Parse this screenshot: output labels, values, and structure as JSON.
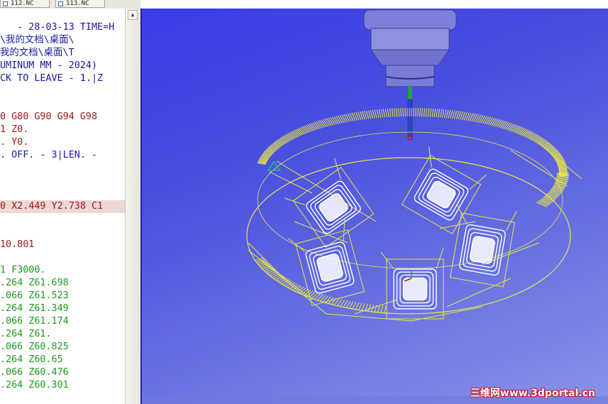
{
  "tabs": [
    {
      "label": "112.NC",
      "active": true
    },
    {
      "label": "113.NC",
      "active": false
    }
  ],
  "code_lines": [
    {
      "text": "",
      "color": "blue"
    },
    {
      "text": "   - 28-03-13 TIME=H",
      "color": "blue"
    },
    {
      "text": "\\我的文档\\桌面\\",
      "color": "blue"
    },
    {
      "text": "我的文档\\桌面\\T",
      "color": "blue"
    },
    {
      "text": "UMINUM MM - 2024)",
      "color": "blue"
    },
    {
      "text": "CK TO LEAVE - 1.|Z",
      "color": "blue"
    },
    {
      "text": "",
      "color": "blue"
    },
    {
      "text": "",
      "color": "blue"
    },
    {
      "text": "0 G80 G90 G94 G98",
      "color": "red"
    },
    {
      "text": "1 Z0.",
      "color": "red"
    },
    {
      "text": ". Y0.",
      "color": "red"
    },
    {
      "text": ". OFF. - 3|LEN. -",
      "color": "blue"
    },
    {
      "text": "",
      "color": "blue"
    },
    {
      "text": "",
      "color": "blue"
    },
    {
      "text": "",
      "color": "blue"
    },
    {
      "text": "0 X2.449 Y2.738 C1",
      "color": "red",
      "highlight": true
    },
    {
      "text": "",
      "color": "blue"
    },
    {
      "text": "",
      "color": "blue"
    },
    {
      "text": "10.801",
      "color": "red"
    },
    {
      "text": "",
      "color": "blue"
    },
    {
      "text": "1 F3000.",
      "color": "green"
    },
    {
      "text": ".264 Z61.698",
      "color": "green"
    },
    {
      "text": ".066 Z61.523",
      "color": "green"
    },
    {
      "text": ".264 Z61.349",
      "color": "green"
    },
    {
      "text": ".066 Z61.174",
      "color": "green"
    },
    {
      "text": ".264 Z61.",
      "color": "green"
    },
    {
      "text": ".066 Z60.825",
      "color": "green"
    },
    {
      "text": ".264 Z60.65",
      "color": "green"
    },
    {
      "text": ".066 Z60.476",
      "color": "green"
    },
    {
      "text": ".264 Z60.301",
      "color": "green"
    }
  ],
  "colors": {
    "blue_text": "#1a1aa0",
    "red_text": "#a01818",
    "green_text": "#1a9a1a",
    "highlight": "#ecd7d4",
    "toolpath": "#e6e64a",
    "viewport_bg": "#4a4fdf"
  },
  "icons": {
    "tab_icon": "nc-file-icon",
    "scroll_up": "scroll-up-arrow-icon"
  },
  "viewport": {
    "watermark": "三维网www.3dportal.cn"
  }
}
